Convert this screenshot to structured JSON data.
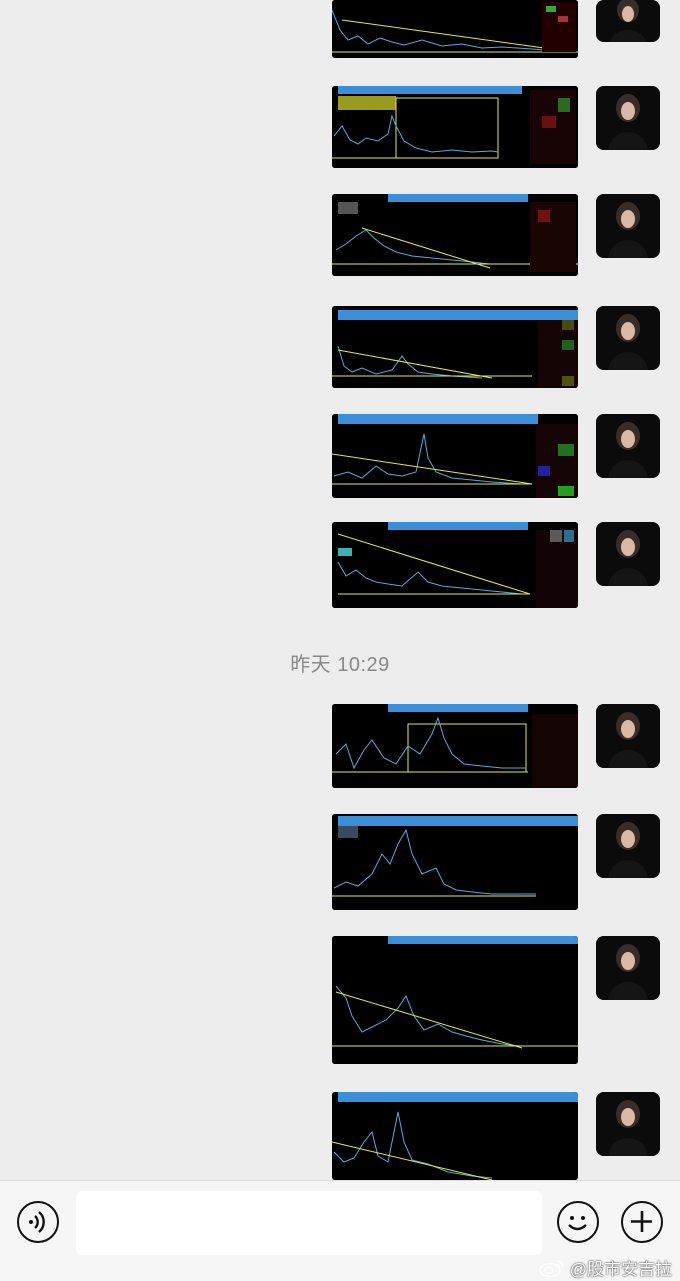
{
  "chat": {
    "time_separator": "昨天 10:29",
    "messages_before_separator": 6,
    "messages_after_separator": 4
  },
  "input": {
    "placeholder": ""
  },
  "toolbar": {
    "voice_icon": "voice-wave-icon",
    "emoji_icon": "smiley-face-icon",
    "plus_icon": "plus-icon"
  },
  "watermark": {
    "text": "@股市安吉拉"
  },
  "colors": {
    "background": "#ededed",
    "chart_background": "#000000",
    "chart_header": "#3a8fd8",
    "trend_line": "#e8e84a"
  }
}
